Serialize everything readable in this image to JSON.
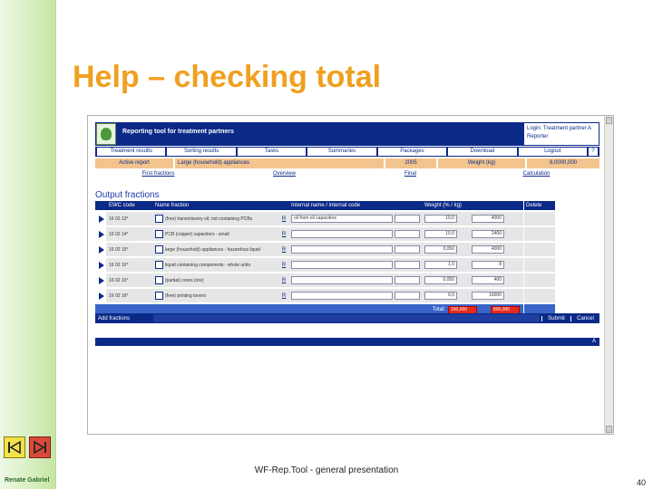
{
  "slide": {
    "title": "Help – checking total",
    "footer": "WF-Rep.Tool - general presentation",
    "author": "Renate Gabriel",
    "page_number": "40"
  },
  "app": {
    "title": "Reporting tool for treatment partners",
    "login_line1": "Login: Treatment partner A",
    "login_line2": "Reporter",
    "tabs": [
      "Treatment results",
      "Sorting results",
      "Tasks",
      "Summaries",
      "Packages",
      "Download",
      "Logout"
    ],
    "tab_extra": "?",
    "info": {
      "active_label": "Active report",
      "active_value": "Large (household) appliances",
      "year": "2005",
      "weight_label": "Weight (kg)",
      "weight_value": "8,0000,000"
    },
    "subnav": [
      "First fractions",
      "Overview",
      "Final",
      "Calculation"
    ],
    "section": "Output fractions",
    "columns": {
      "ewc": "EWC code",
      "name": "Name fraction",
      "internal": "Internal name / internal code",
      "weight": "Weight (% / kg)",
      "delete": "Delete"
    },
    "rows": [
      {
        "ewc": "16 02 13*",
        "name": "(free) transmissory oil; not containing PCBs",
        "r": "R",
        "internal": "oil from oil capacitors",
        "pct": "10,0",
        "kg": "4000"
      },
      {
        "ewc": "16 02 14*",
        "name": "PCB (copper) capacitors - small",
        "r": "R",
        "internal": "",
        "pct": "10,0",
        "kg": "2400"
      },
      {
        "ewc": "16 02 15*",
        "name": "large (household) appliances - hazardous liquid",
        "r": "R",
        "internal": "",
        "pct": "0,050",
        "kg": "4000"
      },
      {
        "ewc": "16 02 16*",
        "name": "liquid containing components - whole units",
        "r": "R",
        "internal": "",
        "pct": "1,0",
        "kg": "8"
      },
      {
        "ewc": "16 02 16*",
        "name": "(partial) cores (ore)",
        "r": "R",
        "internal": "",
        "pct": "0,050",
        "kg": "400"
      },
      {
        "ewc": "16 02 16*",
        "name": "(free) printing toners",
        "r": "R",
        "internal": "",
        "pct": "0,5",
        "kg": "16000"
      }
    ],
    "total_label": "Total:",
    "total_pct": "100,000",
    "total_kg": "800,000",
    "add_fractions": "Add fractions",
    "submit": "Submit",
    "cancel": "Cancel",
    "bottom_control": "A"
  },
  "icons": {
    "prev": "prev-slide-icon",
    "next": "next-slide-icon",
    "play": "play-icon",
    "logo": "app-logo-icon"
  },
  "colors": {
    "title": "#f0a020",
    "app_blue": "#0b2a88",
    "info_orange": "#f3c48e",
    "total_red": "#e62a1a"
  }
}
